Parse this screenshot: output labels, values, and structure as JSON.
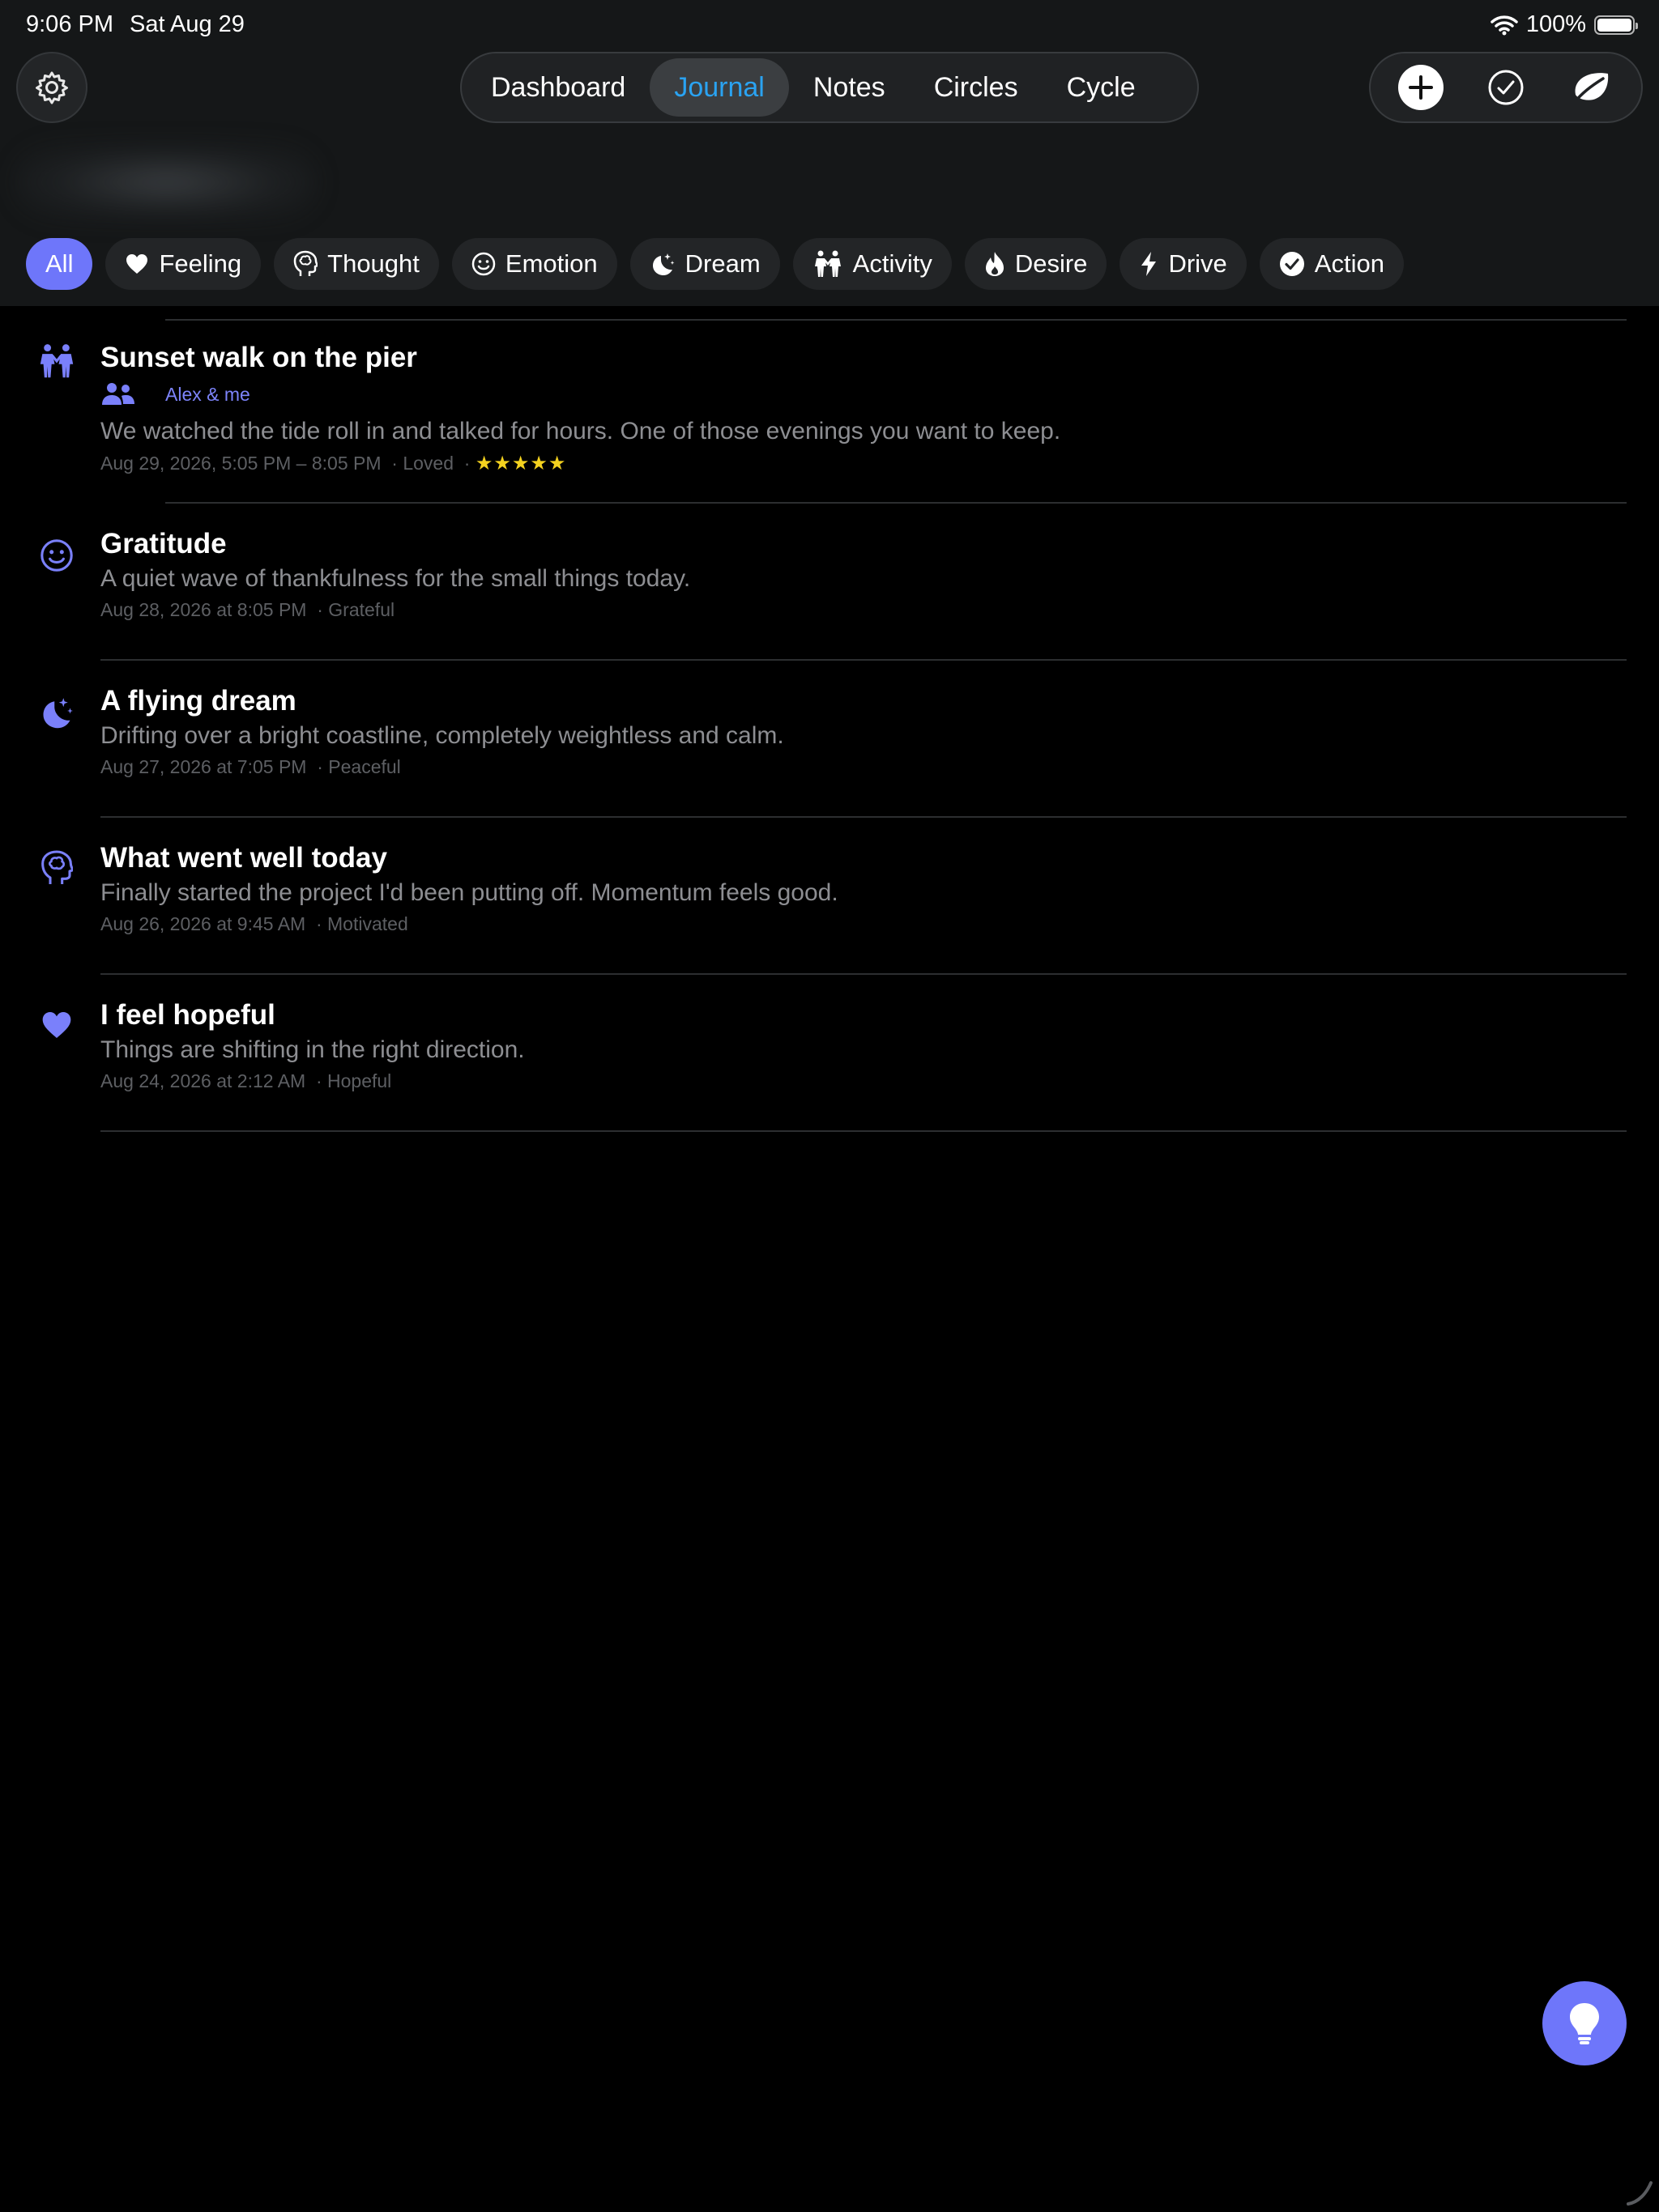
{
  "status_bar": {
    "time": "9:06 PM",
    "date": "Sat Aug 29",
    "battery": "100%"
  },
  "nav": {
    "tabs": [
      {
        "label": "Dashboard"
      },
      {
        "label": "Journal",
        "active": true
      },
      {
        "label": "Notes"
      },
      {
        "label": "Circles"
      },
      {
        "label": "Cycle"
      }
    ]
  },
  "filters": [
    {
      "label": "All",
      "icon": "none",
      "active": true
    },
    {
      "label": "Feeling",
      "icon": "heart-icon"
    },
    {
      "label": "Thought",
      "icon": "brain-head-icon"
    },
    {
      "label": "Emotion",
      "icon": "smiley-icon"
    },
    {
      "label": "Dream",
      "icon": "moon-stars-icon"
    },
    {
      "label": "Activity",
      "icon": "two-people-icon"
    },
    {
      "label": "Desire",
      "icon": "flame-icon"
    },
    {
      "label": "Drive",
      "icon": "bolt-icon"
    },
    {
      "label": "Action",
      "icon": "checkmark-circle-icon"
    }
  ],
  "entries": [
    {
      "icon": "two-people-icon",
      "title": "Sunset walk on the pier",
      "companions": "Alex & me",
      "body": "We watched the tide roll in and talked for hours. One of those evenings you want to keep.",
      "meta": "Aug 29, 2026, 5:05 PM – 8:05 PM  · Loved  · ",
      "stars": "★★★★★"
    },
    {
      "icon": "smiley-icon",
      "title": "Gratitude",
      "body": "A quiet wave of thankfulness for the small things today.",
      "meta": "Aug 28, 2026 at 8:05 PM  · Grateful"
    },
    {
      "icon": "moon-stars-icon",
      "title": "A flying dream",
      "body": "Drifting over a bright coastline, completely weightless and calm.",
      "meta": "Aug 27, 2026 at 7:05 PM  · Peaceful"
    },
    {
      "icon": "brain-head-icon",
      "title": "What went well today",
      "body": "Finally started the project I'd been putting off. Momentum feels good.",
      "meta": "Aug 26, 2026 at 9:45 AM  · Motivated"
    },
    {
      "icon": "heart-icon",
      "title": "I feel hopeful",
      "body": "Things are shifting in the right direction.",
      "meta": "Aug 24, 2026 at 2:12 AM  · Hopeful"
    }
  ],
  "colors": {
    "accent": "#6e76fa",
    "active_tab_text": "#2aa3f2",
    "star": "#f4d21f"
  }
}
